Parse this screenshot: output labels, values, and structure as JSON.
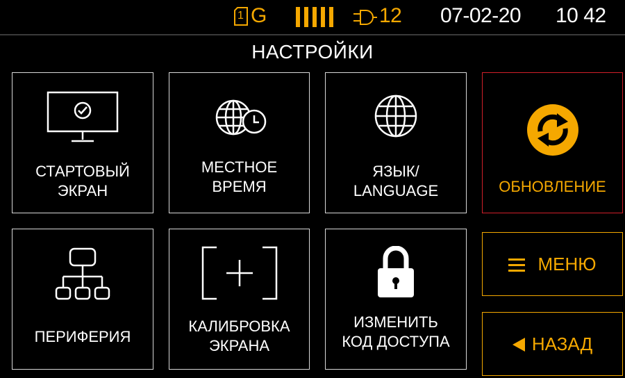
{
  "status": {
    "sim_label": "1",
    "network": "G",
    "signal_bars": 5,
    "power_value": "12",
    "date": "07-02-20",
    "time": "10 42"
  },
  "page_title": "НАСТРОЙКИ",
  "tiles": [
    {
      "label": "СТАРТОВЫЙ\nЭКРАН",
      "icon": "monitor-check-icon"
    },
    {
      "label": "МЕСТНОЕ\nВРЕМЯ",
      "icon": "globe-clock-icon"
    },
    {
      "label": "ЯЗЫК/\nLANGUAGE",
      "icon": "globe-icon"
    },
    {
      "label": "ОБНОВЛЕНИЕ",
      "icon": "refresh-icon"
    },
    {
      "label": "ПЕРИФЕРИЯ",
      "icon": "network-tree-icon"
    },
    {
      "label": "КАЛИБРОВКА\nЭКРАНА",
      "icon": "crosshair-bracket-icon"
    },
    {
      "label": "ИЗМЕНИТЬ\nКОД ДОСТУПА",
      "icon": "lock-icon"
    }
  ],
  "buttons": {
    "menu": "МЕНЮ",
    "back": "НАЗАД",
    "menu_icon": "hamburger-icon",
    "back_icon": "triangle-left-icon"
  },
  "colors": {
    "accent": "#f5a800",
    "selected_border": "#d21f2a",
    "tile_border": "#d9d9d9",
    "background": "#000000"
  }
}
